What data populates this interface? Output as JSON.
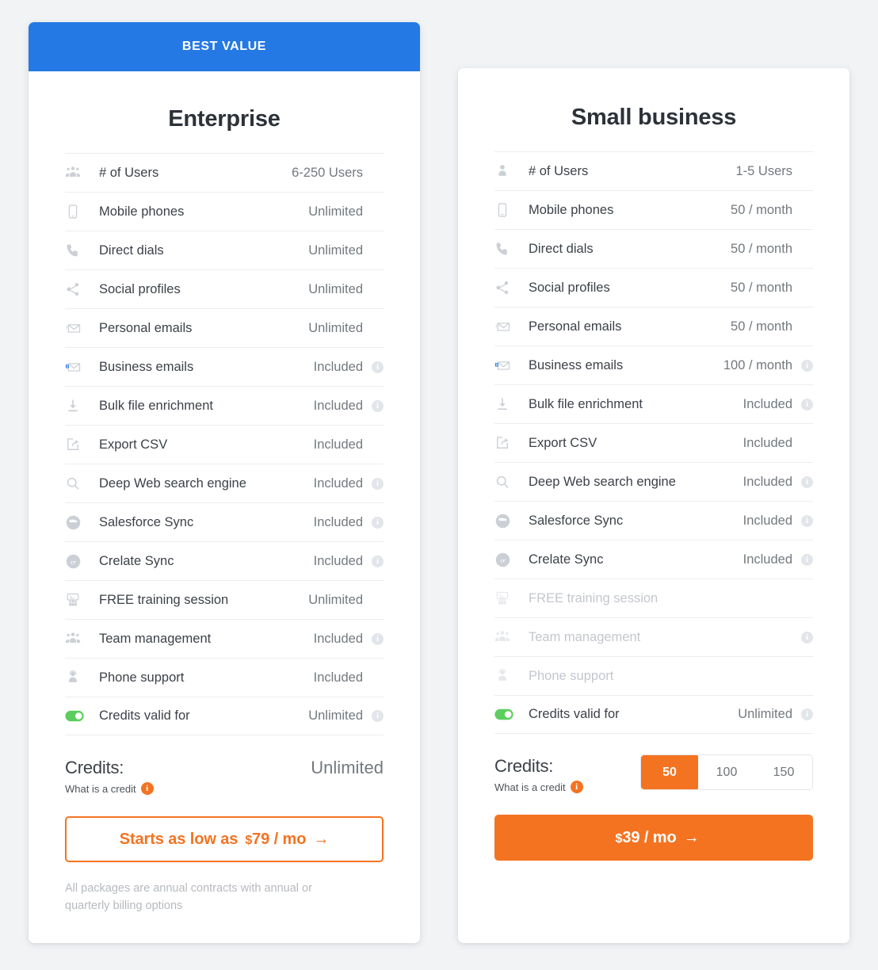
{
  "colors": {
    "banner_blue": "#2479e4",
    "accent_orange": "#f47321",
    "toggle_green": "#5dce5d",
    "business_email_blue": "#1f6fe0"
  },
  "plans": [
    {
      "id": "enterprise",
      "badge": "BEST VALUE",
      "title": "Enterprise",
      "features": [
        {
          "icon": "users-group-icon",
          "label": "# of Users",
          "value": "6-250 Users",
          "info": false,
          "disabled": false
        },
        {
          "icon": "mobile-phone-icon",
          "label": "Mobile phones",
          "value": "Unlimited",
          "info": false,
          "disabled": false
        },
        {
          "icon": "phone-handset-icon",
          "label": "Direct dials",
          "value": "Unlimited",
          "info": false,
          "disabled": false
        },
        {
          "icon": "share-nodes-icon",
          "label": "Social profiles",
          "value": "Unlimited",
          "info": false,
          "disabled": false
        },
        {
          "icon": "personal-email-icon",
          "label": "Personal emails",
          "value": "Unlimited",
          "info": false,
          "disabled": false
        },
        {
          "icon": "business-email-icon",
          "label": "Business emails",
          "value": "Included",
          "info": true,
          "disabled": false
        },
        {
          "icon": "download-file-icon",
          "label": "Bulk file enrichment",
          "value": "Included",
          "info": true,
          "disabled": false
        },
        {
          "icon": "export-csv-icon",
          "label": "Export CSV",
          "value": "Included",
          "info": false,
          "disabled": false
        },
        {
          "icon": "search-icon",
          "label": "Deep Web search engine",
          "value": "Included",
          "info": true,
          "disabled": false
        },
        {
          "icon": "salesforce-cloud-icon",
          "label": "Salesforce Sync",
          "value": "Included",
          "info": true,
          "disabled": false
        },
        {
          "icon": "crelate-icon",
          "label": "Crelate Sync",
          "value": "Included",
          "info": true,
          "disabled": false
        },
        {
          "icon": "training-board-icon",
          "label": "FREE training session",
          "value": "Unlimited",
          "info": false,
          "disabled": false
        },
        {
          "icon": "users-group-icon",
          "label": "Team management",
          "value": "Included",
          "info": true,
          "disabled": false
        },
        {
          "icon": "headset-support-icon",
          "label": "Phone support",
          "value": "Included",
          "info": false,
          "disabled": false
        },
        {
          "icon": "toggle-on-icon",
          "label": "Credits valid for",
          "value": "Unlimited",
          "info": true,
          "disabled": false
        }
      ],
      "credits": {
        "label": "Credits:",
        "sublink": "What is a credit",
        "value": "Unlimited",
        "options": null,
        "selected": null
      },
      "cta": {
        "prefix": "Starts as low as",
        "dollar": "$",
        "price": "79 / mo",
        "arrow": "→",
        "style": "outline"
      },
      "fineprint": "All packages are annual contracts with annual or quarterly billing options"
    },
    {
      "id": "small-business",
      "badge": null,
      "title": "Small business",
      "features": [
        {
          "icon": "single-user-icon",
          "label": "# of Users",
          "value": "1-5 Users",
          "info": false,
          "disabled": false
        },
        {
          "icon": "mobile-phone-icon",
          "label": "Mobile phones",
          "value": "50 / month",
          "info": false,
          "disabled": false
        },
        {
          "icon": "phone-handset-icon",
          "label": "Direct dials",
          "value": "50 / month",
          "info": false,
          "disabled": false
        },
        {
          "icon": "share-nodes-icon",
          "label": "Social profiles",
          "value": "50 / month",
          "info": false,
          "disabled": false
        },
        {
          "icon": "personal-email-icon",
          "label": "Personal emails",
          "value": "50 / month",
          "info": false,
          "disabled": false
        },
        {
          "icon": "business-email-icon",
          "label": "Business emails",
          "value": "100 / month",
          "info": true,
          "disabled": false
        },
        {
          "icon": "download-file-icon",
          "label": "Bulk file enrichment",
          "value": "Included",
          "info": true,
          "disabled": false
        },
        {
          "icon": "export-csv-icon",
          "label": "Export CSV",
          "value": "Included",
          "info": false,
          "disabled": false
        },
        {
          "icon": "search-icon",
          "label": "Deep Web search engine",
          "value": "Included",
          "info": true,
          "disabled": false
        },
        {
          "icon": "salesforce-cloud-icon",
          "label": "Salesforce Sync",
          "value": "Included",
          "info": true,
          "disabled": false
        },
        {
          "icon": "crelate-icon",
          "label": "Crelate Sync",
          "value": "Included",
          "info": true,
          "disabled": false
        },
        {
          "icon": "training-board-icon",
          "label": "FREE training session",
          "value": "",
          "info": false,
          "disabled": true
        },
        {
          "icon": "users-group-icon",
          "label": "Team management",
          "value": "",
          "info": true,
          "disabled": true
        },
        {
          "icon": "headset-support-icon",
          "label": "Phone support",
          "value": "",
          "info": false,
          "disabled": true
        },
        {
          "icon": "toggle-on-icon",
          "label": "Credits valid for",
          "value": "Unlimited",
          "info": true,
          "disabled": false
        }
      ],
      "credits": {
        "label": "Credits:",
        "sublink": "What is a credit",
        "value": null,
        "options": [
          "50",
          "100",
          "150"
        ],
        "selected": "50"
      },
      "cta": {
        "prefix": "",
        "dollar": "$",
        "price": "39 / mo",
        "arrow": "→",
        "style": "solid"
      },
      "fineprint": ""
    }
  ]
}
